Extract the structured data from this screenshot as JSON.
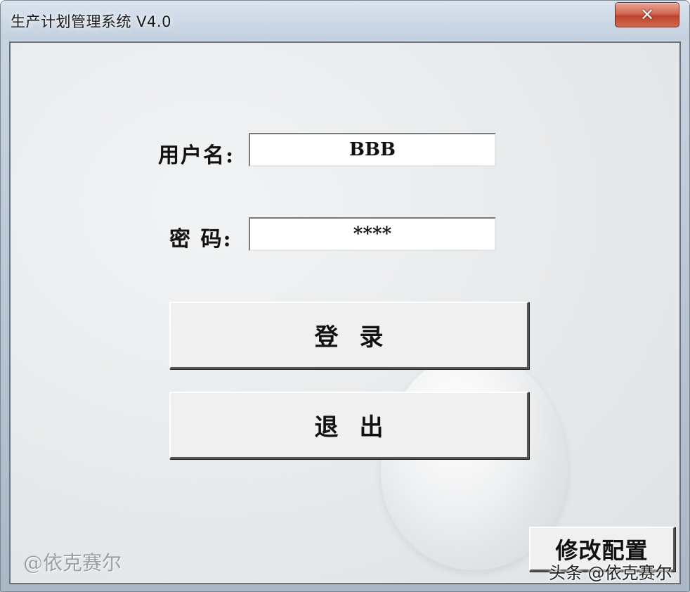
{
  "window": {
    "title": "生产计划管理系统 V4.0",
    "close_icon": "close-icon"
  },
  "form": {
    "username_label": "用户名:",
    "username_value": "BBB",
    "password_label": "密 码:",
    "password_value": "****"
  },
  "buttons": {
    "login_label": "登录",
    "exit_label": "退出",
    "modify_config_label": "修改配置"
  },
  "watermarks": {
    "left": "@依克赛尔",
    "right": "头条 @依克赛尔"
  },
  "colors": {
    "close_button": "#c0432c",
    "client_background": "#e8ebed",
    "titlebar": "#cdd9e6"
  }
}
